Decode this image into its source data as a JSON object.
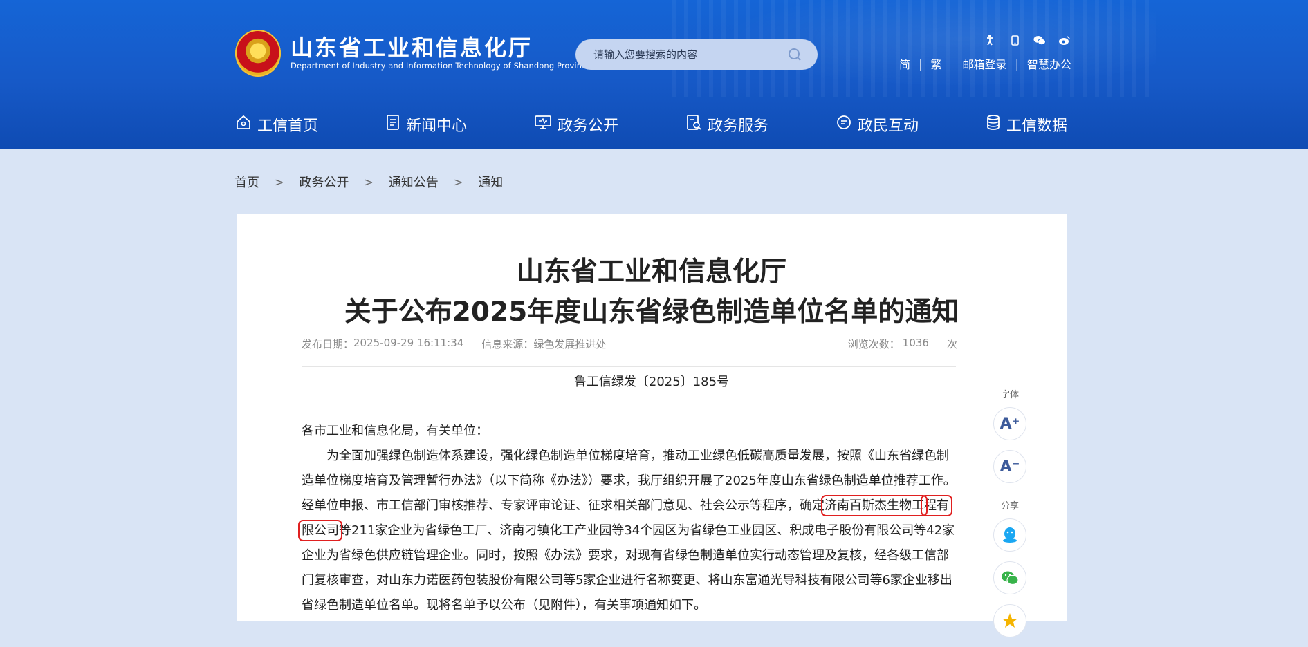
{
  "header": {
    "site_name_cn": "山东省工业和信息化厅",
    "site_name_en": "Department of Industry and Information Technology of Shandong Province",
    "search_placeholder": "请输入您要搜索的内容",
    "top_icons": [
      "accessibility-icon",
      "mobile-icon",
      "wechat-icon",
      "weibo-icon"
    ],
    "top_links": {
      "simplified": "简",
      "traditional": "繁",
      "mail_login": "邮箱登录",
      "smart_office": "智慧办公"
    }
  },
  "nav": {
    "items": [
      {
        "label": "工信首页",
        "icon": "home-icon"
      },
      {
        "label": "新闻中心",
        "icon": "news-icon"
      },
      {
        "label": "政务公开",
        "icon": "monitor-icon"
      },
      {
        "label": "政务服务",
        "icon": "service-icon"
      },
      {
        "label": "政民互动",
        "icon": "chat-icon"
      },
      {
        "label": "工信数据",
        "icon": "database-icon"
      }
    ]
  },
  "breadcrumb": [
    "首页",
    "政务公开",
    "通知公告",
    "通知"
  ],
  "breadcrumb_sep": ">",
  "article": {
    "title_line1": "山东省工业和信息化厅",
    "title_line2": "关于公布2025年度山东省绿色制造单位名单的通知",
    "date_label": "发布日期：",
    "date_value": "2025-09-29 16:11:34",
    "source_label": "信息来源：",
    "source_value": "绿色发展推进处",
    "views_label": "浏览次数：",
    "views_value": "1036",
    "views_unit": "次",
    "doc_number": "鲁工信绿发〔2025〕185号",
    "salutation": "各市工业和信息化局，有关单位：",
    "para_before_1": "为全面加强绿色制造体系建设，强化绿色制造单位梯度培育，推动工业绿色低碳高质量发展，按照《山东省绿色制造单位梯度培育及管理暂行办法》（以下简称《办法》）要求，我厅组织开展了2025年度山东省绿色制造单位推荐工作。经单位申报、市工信部门审核推荐、专家评审论证、征求相关部门意见、社会公示等程序，确定",
    "highlight_a": "济南百斯杰生物工",
    "highlight_b": "程有限公司",
    "para_after": "等211家企业为省绿色工厂、济南刁镇化工产业园等34个园区为省绿色工业园区、积成电子股份有限公司等42家企业为省绿色供应链管理企业。同时，按照《办法》要求，对现有省绿色制造单位实行动态管理及复核，经各级工信部门复核审查，对山东力诺医药包装股份有限公司等5家企业进行名称变更、将山东富通光导科技有限公司等6家企业移出省绿色制造单位名单。现将名单予以公布（见附件），有关事项通知如下。"
  },
  "side_tools": {
    "font_label": "字体",
    "font_increase": "A⁺",
    "font_decrease": "A⁻",
    "share_label": "分享",
    "share_icons": [
      "qq-icon",
      "wechat-share-icon",
      "qzone-icon"
    ]
  },
  "colors": {
    "header_blue": "#1565d6",
    "page_bg": "#d9e4f5",
    "highlight_red": "#e02020"
  }
}
